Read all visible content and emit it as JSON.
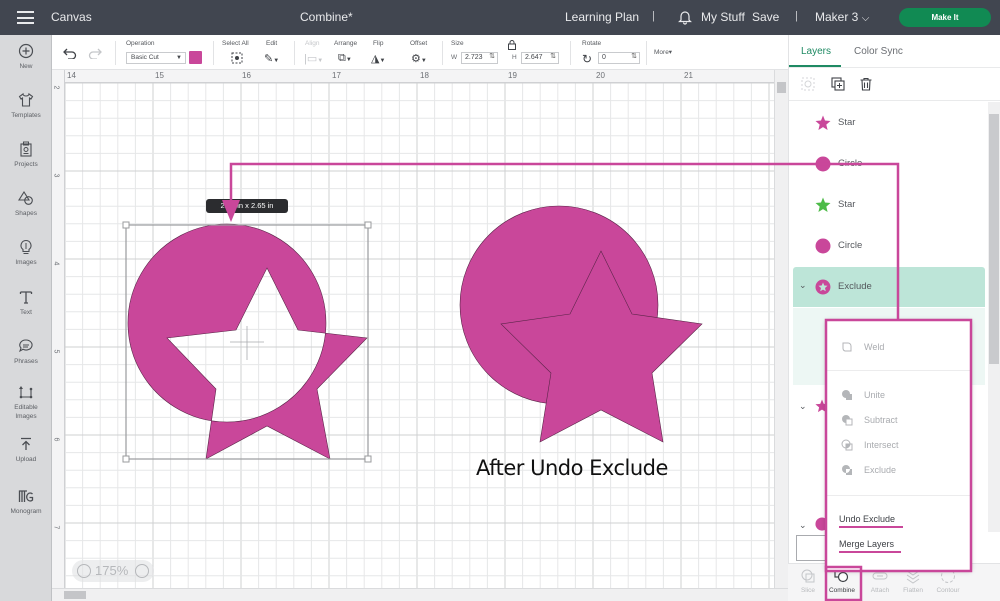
{
  "topbar": {
    "app_name": "Canvas",
    "doc_title": "Combine*",
    "learning_plan": "Learning Plan",
    "separator": "|",
    "my_stuff": "My Stuff",
    "save": "Save",
    "machine": "Maker 3",
    "make_it": "Make It"
  },
  "toolbar": {
    "operation_label": "Operation",
    "operation_value": "Basic Cut",
    "operation_color": "#c9479a",
    "select_all": "Select All",
    "edit": "Edit",
    "align": "Align",
    "arrange": "Arrange",
    "flip": "Flip",
    "offset": "Offset",
    "size_label": "Size",
    "width_label": "W",
    "width_value": "2.723",
    "height_label": "H",
    "height_value": "2.647",
    "rotate_label": "Rotate",
    "rotate_value": "0",
    "more": "More▾"
  },
  "sidebar": {
    "items": [
      {
        "label": "New",
        "icon": "plus-circle-icon"
      },
      {
        "label": "Templates",
        "icon": "tshirt-icon"
      },
      {
        "label": "Projects",
        "icon": "projects-icon"
      },
      {
        "label": "Shapes",
        "icon": "shapes-icon"
      },
      {
        "label": "Images",
        "icon": "lightbulb-icon"
      },
      {
        "label": "Text",
        "icon": "text-icon"
      },
      {
        "label": "Phrases",
        "icon": "speech-bubble-icon"
      },
      {
        "label": "Editable Images",
        "icon": "editable-image-icon"
      },
      {
        "label": "Upload",
        "icon": "upload-icon"
      },
      {
        "label": "Monogram",
        "icon": "monogram-icon"
      }
    ]
  },
  "canvas": {
    "ruler_top": [
      "14",
      "15",
      "16",
      "17",
      "18",
      "19",
      "20",
      "21"
    ],
    "ruler_left": [
      "2",
      "3",
      "4",
      "5",
      "6",
      "7"
    ],
    "dimension_tooltip": "2.72 in x 2.65  in",
    "caption": "After Undo Exclude",
    "zoom_level": "175%",
    "shape_color": "#c9479a"
  },
  "panel": {
    "tabs": [
      "Layers",
      "Color Sync"
    ],
    "layers": [
      {
        "name": "Star",
        "icon": "star-icon",
        "color": "#c9479a"
      },
      {
        "name": "Circle",
        "icon": "circle-icon",
        "color": "#c9479a"
      },
      {
        "name": "Star",
        "icon": "star-icon",
        "color": "#4dbb48"
      },
      {
        "name": "Circle",
        "icon": "circle-icon",
        "color": "#c9479a"
      },
      {
        "name": "Exclude",
        "icon": "exclude-group-icon",
        "color": "#c9479a"
      }
    ]
  },
  "combine_menu": {
    "weld": "Weld",
    "unite": "Unite",
    "subtract": "Subtract",
    "intersect": "Intersect",
    "exclude": "Exclude",
    "undo_exclude": "Undo Exclude",
    "merge_layers": "Merge Layers"
  },
  "bottom_tools": {
    "slice": "Slice",
    "combine": "Combine",
    "attach": "Attach",
    "flatten": "Flatten",
    "contour": "Contour"
  },
  "colors": {
    "accent_green": "#1f8a63",
    "make_it_green": "#118a53",
    "annotation_magenta": "#c9479a",
    "selected_layer_bg": "#bde5d8"
  }
}
